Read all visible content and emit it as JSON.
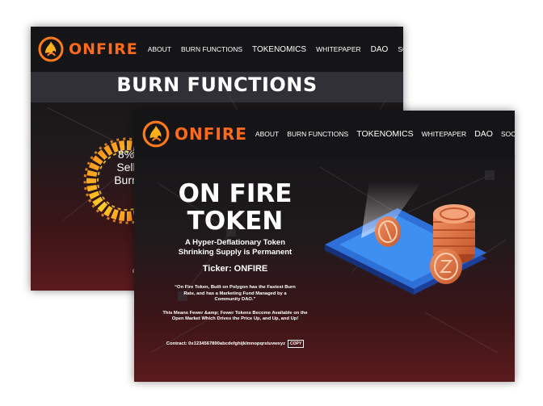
{
  "brand": {
    "name": "ONFIRE",
    "logo_color": "#ff6a1a"
  },
  "nav": {
    "items": [
      "ABOUT",
      "BURN FUNCTIONS",
      "TOKENOMICS",
      "WHITEPAPER",
      "DAO",
      "SOCIAL MEDIA"
    ]
  },
  "back_page": {
    "section_title": "BURN FUNCTIONS",
    "ring_text": [
      "8%",
      "Sell",
      "Burn"
    ],
    "footer_fragment": "c"
  },
  "front_page": {
    "title_line1": "ON FIRE",
    "title_line2": "TOKEN",
    "subtitle_line1": "A Hyper-Deflationary Token",
    "subtitle_line2": "Shrinking Supply is Permanent",
    "ticker": "Ticker: ONFIRE",
    "quote": "“On Fire Token, Built on Polygon has the Fastest Burn Rate, and has a Marketing Fund Managed by a Community DAO.”",
    "means": "This Means Fewer &amp; Fewer Tokens Become Available on the Open Market Which Drives the Price Up, and Up, and Up!",
    "contract": "Contract: 0x1234567890abcdefghijklmnopqrstuvwxyz",
    "copy_label": "COPY"
  },
  "colors": {
    "brand_orange": "#ff6a1a",
    "navbar": "#151517",
    "background_dark": "#141416",
    "background_red": "#5a1a1c",
    "phone_blue": "#2f6fd8",
    "coin_copper": "#e07a4a"
  }
}
